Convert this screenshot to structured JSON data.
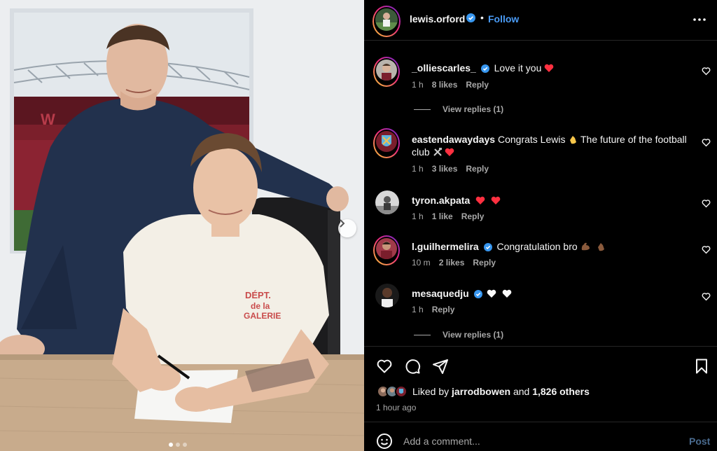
{
  "post": {
    "author": "lewis.orford",
    "follow_label": "Follow",
    "separator": "•",
    "carousel": {
      "total": 3,
      "current": 1
    },
    "shirt_text": [
      "DÉPT.",
      "de la",
      "GALERIE"
    ]
  },
  "comments": [
    {
      "user": "_olliescarles_",
      "verified": true,
      "text": "Love it you ",
      "emoji": [
        "red-heart"
      ],
      "time": "1 h",
      "likes": "8 likes",
      "reply": "Reply",
      "view_replies": "View replies (1)",
      "ring": true
    },
    {
      "user": "eastendawaydays",
      "verified": false,
      "text": "Congrats Lewis ",
      "text2": " The future of the football club ",
      "emoji": [
        "clapping-hands",
        "hammer-and-pick",
        "red-heart"
      ],
      "time": "1 h",
      "likes": "3 likes",
      "reply": "Reply",
      "ring": true
    },
    {
      "user": "tyron.akpata",
      "verified": false,
      "text": "",
      "emoji": [
        "red-heart",
        "red-heart"
      ],
      "time": "1 h",
      "likes": "1 like",
      "reply": "Reply",
      "ring": false
    },
    {
      "user": "l.guilhermelira",
      "verified": true,
      "text": "Congratulation bro ",
      "emoji": [
        "flexed-biceps",
        "clapping-hands"
      ],
      "time": "10 m",
      "likes": "2 likes",
      "reply": "Reply",
      "ring": true
    },
    {
      "user": "mesaquedju",
      "verified": true,
      "text": "",
      "emoji": [
        "white-heart",
        "white-heart"
      ],
      "time": "1 h",
      "likes": "",
      "reply": "Reply",
      "view_replies": "View replies (1)",
      "ring": false
    }
  ],
  "likes": {
    "prefix": "Liked by ",
    "user": "jarrodbowen",
    "middle": " and ",
    "others": "1,826 others"
  },
  "time_ago": "1 hour ago",
  "add_comment": {
    "placeholder": "Add a comment...",
    "post_label": "Post"
  },
  "colors": {
    "accent": "#4a9bf5",
    "verified": "#3897f0",
    "heart": "#ff3040",
    "shirt_text": "#c94b4b"
  },
  "icons": [
    "more-icon",
    "heart-icon",
    "comment-icon",
    "share-icon",
    "bookmark-icon",
    "emoji-icon",
    "chevron-right-icon",
    "verified-icon"
  ]
}
